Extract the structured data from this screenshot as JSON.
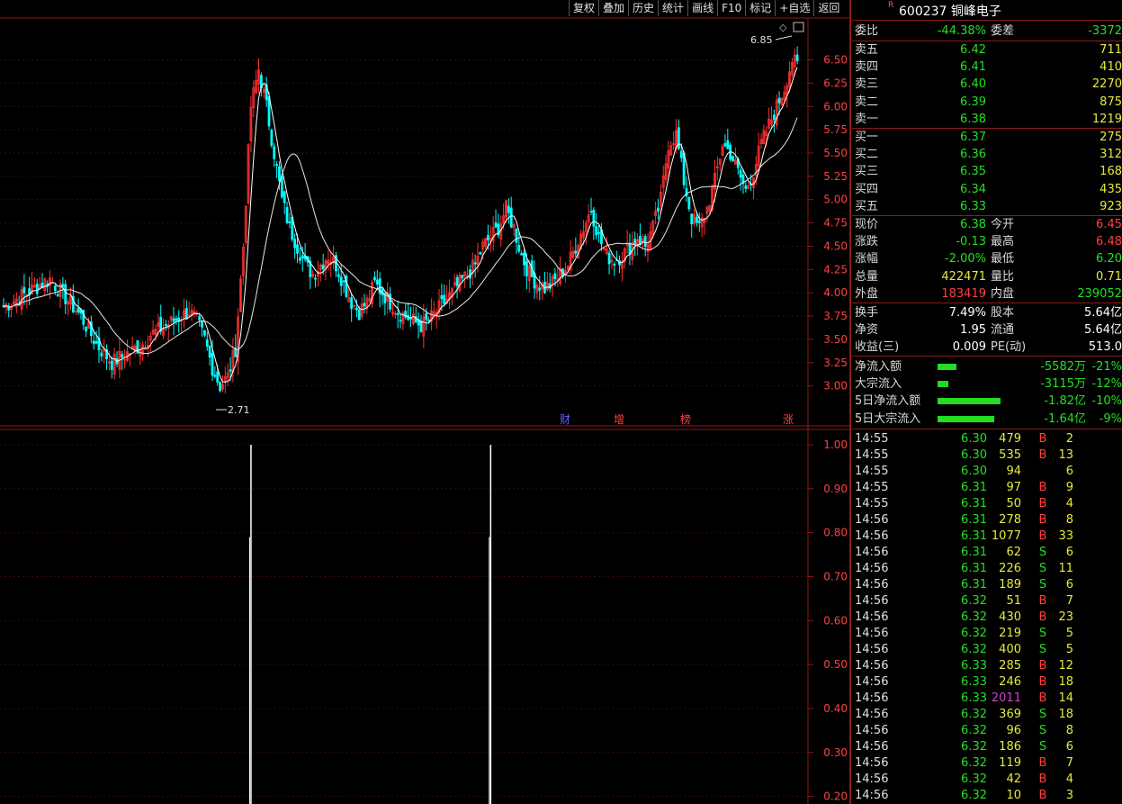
{
  "toolbar": [
    "复权",
    "叠加",
    "历史",
    "统计",
    "画线",
    "F10",
    "标记",
    "+自选",
    "返回"
  ],
  "stock": {
    "code": "600237",
    "name": "铜峰电子",
    "mark": "R"
  },
  "price_axis": [
    "6.50",
    "6.25",
    "6.00",
    "5.75",
    "5.50",
    "5.25",
    "5.00",
    "4.75",
    "4.50",
    "4.25",
    "4.00",
    "3.75",
    "3.50",
    "3.25",
    "3.00"
  ],
  "indicator_axis": [
    "1.00",
    "0.90",
    "0.80",
    "0.70",
    "0.60",
    "0.50",
    "0.40",
    "0.30",
    "0.20"
  ],
  "annotations": {
    "high": "6.85",
    "low": "2.71"
  },
  "event_markers": [
    "财",
    "增",
    "榜",
    "涨"
  ],
  "order_book": {
    "header": {
      "l1": "委比",
      "v1": "-44.38%",
      "l2": "委差",
      "v2": "-3372"
    },
    "asks": [
      {
        "label": "卖五",
        "price": "6.42",
        "vol": "711"
      },
      {
        "label": "卖四",
        "price": "6.41",
        "vol": "410"
      },
      {
        "label": "卖三",
        "price": "6.40",
        "vol": "2270"
      },
      {
        "label": "卖二",
        "price": "6.39",
        "vol": "875"
      },
      {
        "label": "卖一",
        "price": "6.38",
        "vol": "1219"
      }
    ],
    "bids": [
      {
        "label": "买一",
        "price": "6.37",
        "vol": "275"
      },
      {
        "label": "买二",
        "price": "6.36",
        "vol": "312"
      },
      {
        "label": "买三",
        "price": "6.35",
        "vol": "168"
      },
      {
        "label": "买四",
        "price": "6.34",
        "vol": "435"
      },
      {
        "label": "买五",
        "price": "6.33",
        "vol": "923"
      }
    ]
  },
  "quote": [
    {
      "l1": "现价",
      "v1": "6.38",
      "l2": "今开",
      "v2": "6.45"
    },
    {
      "l1": "涨跌",
      "v1": "-0.13",
      "l2": "最高",
      "v2": "6.48"
    },
    {
      "l1": "涨幅",
      "v1": "-2.00%",
      "l2": "最低",
      "v2": "6.20"
    },
    {
      "l1": "总量",
      "v1": "422471",
      "l2": "量比",
      "v2": "0.71"
    },
    {
      "l1": "外盘",
      "v1": "183419",
      "l2": "内盘",
      "v2": "239052"
    }
  ],
  "fundamentals": [
    {
      "l1": "换手",
      "v1": "7.49%",
      "l2": "股本",
      "v2": "5.64亿"
    },
    {
      "l1": "净资",
      "v1": "1.95",
      "l2": "流通",
      "v2": "5.64亿"
    },
    {
      "l1": "收益(三)",
      "v1": "0.009",
      "l2": "PE(动)",
      "v2": "513.0"
    }
  ],
  "flows": [
    {
      "label": "净流入额",
      "value": "-5582万",
      "pct": "-21%",
      "level": 0.21
    },
    {
      "label": "大宗流入",
      "value": "-3115万",
      "pct": "-12%",
      "level": 0.12
    },
    {
      "label": "5日净流入额",
      "value": "-1.82亿",
      "pct": "-10%",
      "level": 0.7
    },
    {
      "label": "5日大宗流入",
      "value": "-1.64亿",
      "pct": "-9%",
      "level": 0.63
    }
  ],
  "ticks": [
    {
      "t": "14:55",
      "p": "6.30",
      "v": "479",
      "bs": "B",
      "n": "2"
    },
    {
      "t": "14:55",
      "p": "6.30",
      "v": "535",
      "bs": "B",
      "n": "13"
    },
    {
      "t": "14:55",
      "p": "6.30",
      "v": "94",
      "bs": "",
      "n": "6"
    },
    {
      "t": "14:55",
      "p": "6.31",
      "v": "97",
      "bs": "B",
      "n": "9"
    },
    {
      "t": "14:55",
      "p": "6.31",
      "v": "50",
      "bs": "B",
      "n": "4"
    },
    {
      "t": "14:56",
      "p": "6.31",
      "v": "278",
      "bs": "B",
      "n": "8"
    },
    {
      "t": "14:56",
      "p": "6.31",
      "v": "1077",
      "bs": "B",
      "n": "33"
    },
    {
      "t": "14:56",
      "p": "6.31",
      "v": "62",
      "bs": "S",
      "n": "6"
    },
    {
      "t": "14:56",
      "p": "6.31",
      "v": "226",
      "bs": "S",
      "n": "11"
    },
    {
      "t": "14:56",
      "p": "6.31",
      "v": "189",
      "bs": "S",
      "n": "6"
    },
    {
      "t": "14:56",
      "p": "6.32",
      "v": "51",
      "bs": "B",
      "n": "7"
    },
    {
      "t": "14:56",
      "p": "6.32",
      "v": "430",
      "bs": "B",
      "n": "23"
    },
    {
      "t": "14:56",
      "p": "6.32",
      "v": "219",
      "bs": "S",
      "n": "5"
    },
    {
      "t": "14:56",
      "p": "6.32",
      "v": "400",
      "bs": "S",
      "n": "5"
    },
    {
      "t": "14:56",
      "p": "6.33",
      "v": "285",
      "bs": "B",
      "n": "12"
    },
    {
      "t": "14:56",
      "p": "6.33",
      "v": "246",
      "bs": "B",
      "n": "18"
    },
    {
      "t": "14:56",
      "p": "6.33",
      "v": "2011",
      "bs": "B",
      "n": "14"
    },
    {
      "t": "14:56",
      "p": "6.32",
      "v": "369",
      "bs": "S",
      "n": "18"
    },
    {
      "t": "14:56",
      "p": "6.32",
      "v": "96",
      "bs": "S",
      "n": "8"
    },
    {
      "t": "14:56",
      "p": "6.32",
      "v": "186",
      "bs": "S",
      "n": "6"
    },
    {
      "t": "14:56",
      "p": "6.32",
      "v": "119",
      "bs": "B",
      "n": "7"
    },
    {
      "t": "14:56",
      "p": "6.32",
      "v": "42",
      "bs": "B",
      "n": "4"
    },
    {
      "t": "14:56",
      "p": "6.32",
      "v": "10",
      "bs": "B",
      "n": "3"
    }
  ],
  "colors": {
    "up": "#ff3030",
    "down": "#00ffff",
    "grid": "#8b1a1a",
    "ma": "#ffffff"
  },
  "chart_data": {
    "type": "candlestick",
    "price_range": [
      2.6,
      6.95
    ],
    "indicator_range": [
      0.15,
      1.0
    ],
    "close_path": [
      3.85,
      3.9,
      3.95,
      4.0,
      4.05,
      4.1,
      4.15,
      4.05,
      3.95,
      3.85,
      3.75,
      3.6,
      3.45,
      3.35,
      3.25,
      3.3,
      3.35,
      3.4,
      3.45,
      3.55,
      3.6,
      3.65,
      3.7,
      3.75,
      3.8,
      3.7,
      3.5,
      3.2,
      3.0,
      3.1,
      3.4,
      4.5,
      6.0,
      6.4,
      6.0,
      5.5,
      5.0,
      4.7,
      4.5,
      4.3,
      4.2,
      4.3,
      4.4,
      4.3,
      4.1,
      3.9,
      3.8,
      3.9,
      4.1,
      4.0,
      3.9,
      3.8,
      3.75,
      3.7,
      3.65,
      3.7,
      3.8,
      3.9,
      4.0,
      4.1,
      4.2,
      4.3,
      4.5,
      4.6,
      4.7,
      4.9,
      4.7,
      4.4,
      4.2,
      4.1,
      4.05,
      4.1,
      4.2,
      4.3,
      4.5,
      4.7,
      4.9,
      4.6,
      4.4,
      4.35,
      4.4,
      4.5,
      4.6,
      4.5,
      4.7,
      5.0,
      5.6,
      5.7,
      5.2,
      4.8,
      4.7,
      4.9,
      5.2,
      5.6,
      5.5,
      5.3,
      5.1,
      5.3,
      5.6,
      5.8,
      6.0,
      6.2,
      6.5,
      6.4
    ],
    "indicator_spikes": [
      {
        "index": 32,
        "value": 1.0
      },
      {
        "index": 63,
        "value": 1.0
      }
    ]
  }
}
